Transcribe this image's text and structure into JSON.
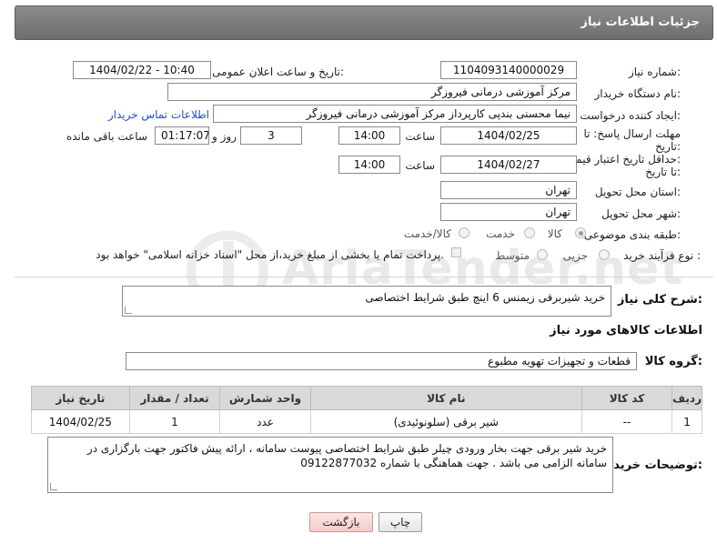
{
  "header": {
    "title": "جزئیات اطلاعات نیاز"
  },
  "form": {
    "need_number": {
      "label": "شماره نیاز:",
      "value": "1104093140000029"
    },
    "announce_datetime": {
      "label": "تاریخ و ساعت اعلان عمومی:",
      "value": "1404/02/22 - 10:40"
    },
    "buyer_org": {
      "label": "نام دستگاه خریدار:",
      "value": "مرکز آموزشی درمانی فیروزگر"
    },
    "requester": {
      "label": "ایجاد کننده درخواست:",
      "value": "نیما محسنی بندپی کارپرداز مرکز آموزشی درمانی فیروزگر",
      "contact_link": "اطلاعات تماس خریدار"
    },
    "reply_deadline": {
      "label_line1": "مهلت ارسال پاسخ: تا",
      "label_line2": "تاریخ:",
      "date": "1404/02/25",
      "time_label": "ساعت",
      "time": "14:00",
      "days": "3",
      "days_label": "روز و",
      "remaining": "01:17:07",
      "remaining_label": "ساعت باقی مانده"
    },
    "price_validity": {
      "label_line1": "حداقل تاریخ اعتبار قیمت:",
      "label_line2": "تا تاریخ:",
      "date": "1404/02/27",
      "time_label": "ساعت",
      "time": "14:00"
    },
    "delivery_province": {
      "label": "استان محل تحویل:",
      "value": "تهران"
    },
    "delivery_city": {
      "label": "شهر محل تحویل:",
      "value": "تهران"
    },
    "category": {
      "label": "طبقه بندی موضوعی:",
      "options": [
        "کالا",
        "خدمت",
        "کالا/خدمت"
      ],
      "selected": "کالا"
    },
    "purchase_process": {
      "label": "نوع فرآیند خرید :",
      "options": [
        "جزیی",
        "متوسط"
      ],
      "note": "پرداخت تمام یا بخشی از مبلغ خرید،از محل \"اسناد خزانه اسلامی\" خواهد بود."
    }
  },
  "general_description": {
    "label": "شرح کلی نیاز:",
    "value": "خرید شیربرقی زیمنس 6 اینچ طبق شرایط اختصاصی"
  },
  "goods_section": {
    "title": "اطلاعات کالاهای مورد نیاز",
    "group_label": "گروه کالا:",
    "group_value": "قطعات و تجهیزات تهویه مطبوع",
    "table": {
      "headers": [
        "ردیف",
        "کد کالا",
        "نام کالا",
        "واحد شمارش",
        "تعداد / مقدار",
        "تاریخ نیاز"
      ],
      "rows": [
        {
          "row": "1",
          "code": "--",
          "name": "شیر برقی (سلونوئیدی)",
          "unit": "عدد",
          "qty": "1",
          "date": "1404/02/25"
        }
      ]
    }
  },
  "buyer_notes": {
    "label": "توضیحات خریدار:",
    "value": "خرید شیر برقی جهت بخار ورودی چیلر طبق شرایط اختصاصی پیوست سامانه ، ارائه پیش فاکتور جهت بارگزاری در سامانه الزامی می باشد . جهت هماهنگی با شماره 09122877032"
  },
  "buttons": {
    "print": "چاپ",
    "back": "بازگشت"
  },
  "watermark": {
    "text": "AriaTender.net"
  }
}
